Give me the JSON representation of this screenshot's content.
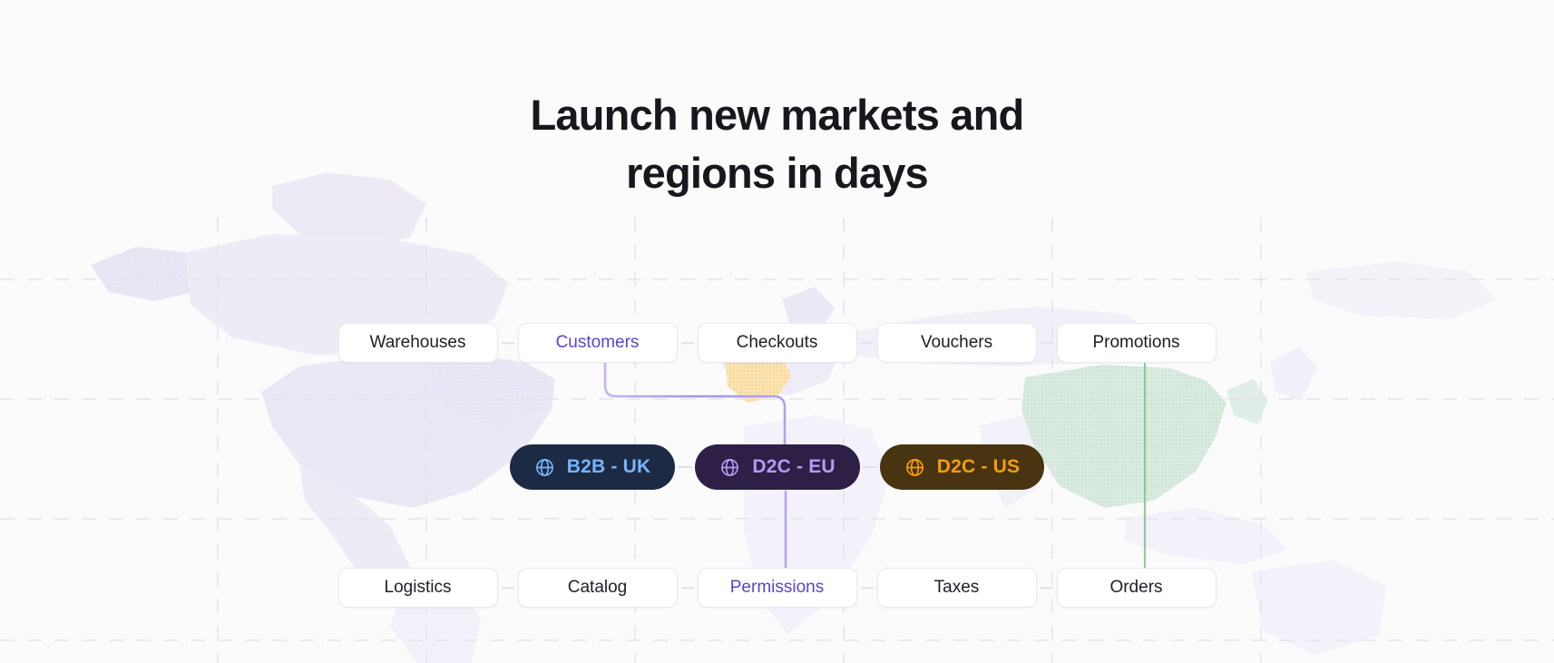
{
  "heading": {
    "line1": "Launch new markets and",
    "line2": "regions in days"
  },
  "colors": {
    "page_background": "#fbfbfc",
    "heading_text": "#16181d",
    "pill_background": "#ffffff",
    "pill_border": "#e6e9ef",
    "pill_text": "#1d1f25",
    "pill_accent_text": "#5b45c7",
    "connector_purple": "#a294e8",
    "connector_green": "#7ec894",
    "grid_dash": "#dfe3ea",
    "map_americas": "#e9e7f5",
    "map_europe_highlight": "#fbdfa6",
    "map_asia_highlight": "#cfe7dc"
  },
  "top_row": {
    "items": [
      {
        "label": "Warehouses",
        "accent": false
      },
      {
        "label": "Customers",
        "accent": true
      },
      {
        "label": "Checkouts",
        "accent": false
      },
      {
        "label": "Vouchers",
        "accent": false
      },
      {
        "label": "Promotions",
        "accent": false
      }
    ]
  },
  "regions": {
    "items": [
      {
        "label": "B2B - UK",
        "icon": "globe-icon",
        "background": "#1d2a44",
        "text_color": "#76b5fb",
        "icon_color": "#76b5fb"
      },
      {
        "label": "D2C - EU",
        "icon": "globe-icon",
        "background": "#2d1f45",
        "text_color": "#b49bf4",
        "icon_color": "#b49bf4"
      },
      {
        "label": "D2C - US",
        "icon": "globe-icon",
        "background": "#483411",
        "text_color": "#f59e0b",
        "icon_color": "#f59e0b"
      }
    ]
  },
  "bottom_row": {
    "items": [
      {
        "label": "Logistics",
        "accent": false
      },
      {
        "label": "Catalog",
        "accent": false
      },
      {
        "label": "Permissions",
        "accent": true
      },
      {
        "label": "Taxes",
        "accent": false
      },
      {
        "label": "Orders",
        "accent": false
      }
    ]
  },
  "connectors": [
    {
      "name": "customers-to-d2c-eu",
      "color": "#a294e8",
      "from": "Customers",
      "to": "D2C - EU"
    },
    {
      "name": "d2c-eu-to-permissions",
      "color": "#a294e8",
      "from": "D2C - EU",
      "to": "Permissions"
    },
    {
      "name": "promotions-to-orders",
      "color": "#7ec894",
      "from": "Promotions",
      "to": "Orders"
    }
  ]
}
